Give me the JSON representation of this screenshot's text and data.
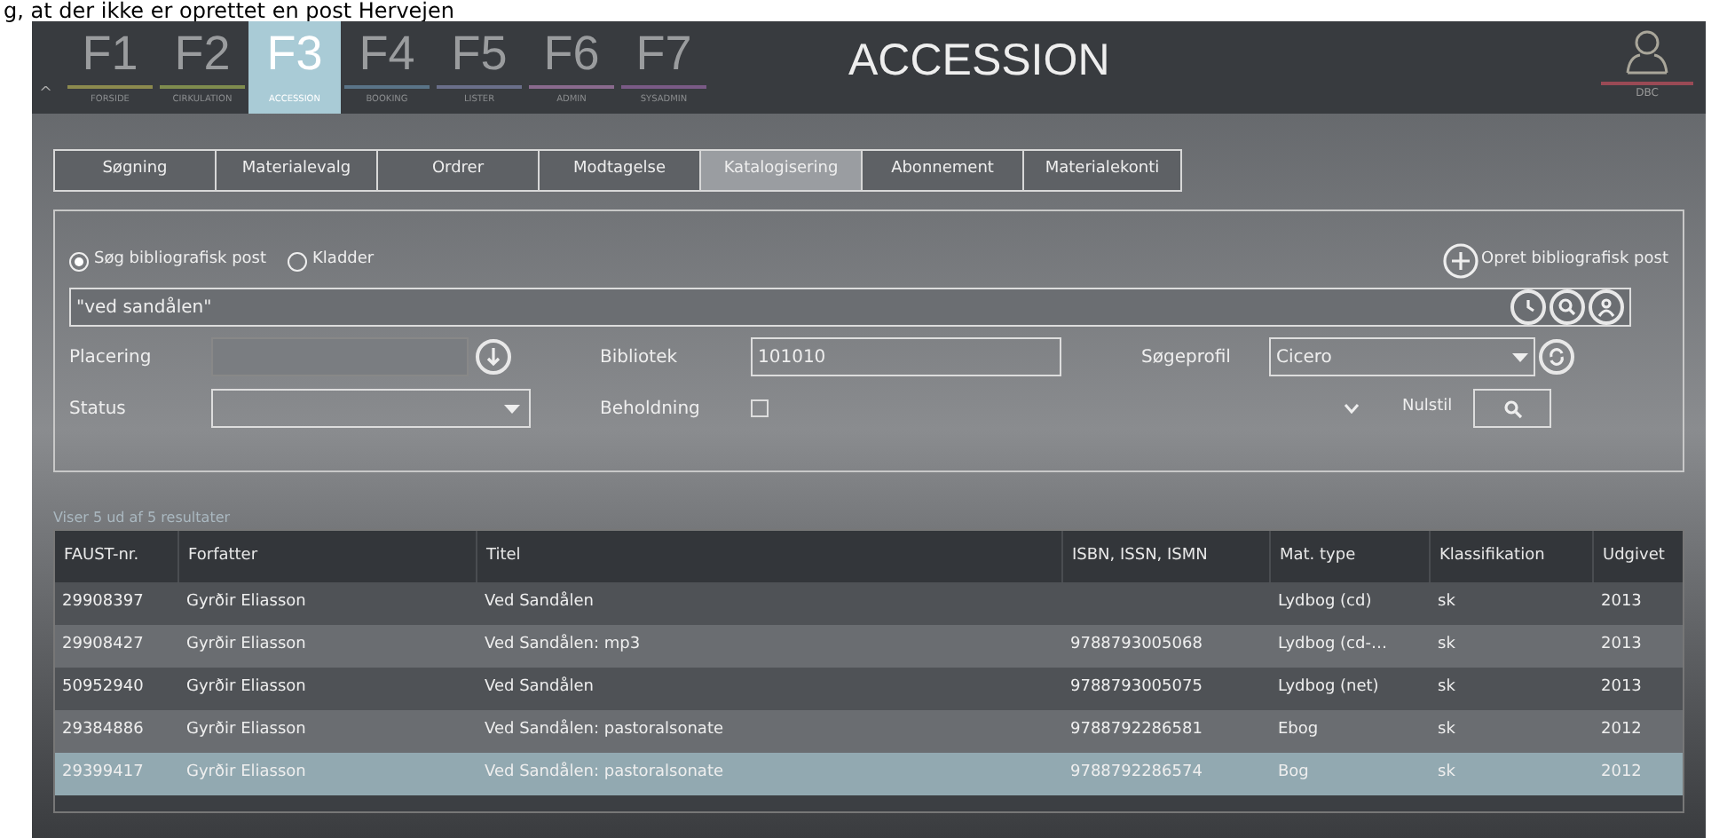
{
  "caption": "g, at der ikke er oprettet en post Hervejen",
  "modules": [
    {
      "key": "F1",
      "label": "FORSIDE",
      "color": "#8c8a4e",
      "selected": false
    },
    {
      "key": "F2",
      "label": "CIRKULATION",
      "color": "#7f8c4e",
      "selected": false
    },
    {
      "key": "F3",
      "label": "ACCESSION",
      "color": "#a9cbd6",
      "selected": true
    },
    {
      "key": "F4",
      "label": "BOOKING",
      "color": "#5a7488",
      "selected": false
    },
    {
      "key": "F5",
      "label": "LISTER",
      "color": "#6a6f8a",
      "selected": false
    },
    {
      "key": "F6",
      "label": "ADMIN",
      "color": "#8a6a8e",
      "selected": false
    },
    {
      "key": "F7",
      "label": "SYSADMIN",
      "color": "#7a5a86",
      "selected": false
    }
  ],
  "collapse_glyph": "^",
  "page_title": "ACCESSION",
  "user": {
    "label": "DBC"
  },
  "tabs": [
    {
      "label": "Søgning",
      "selected": false
    },
    {
      "label": "Materialevalg",
      "selected": false
    },
    {
      "label": "Ordrer",
      "selected": false
    },
    {
      "label": "Modtagelse",
      "selected": false
    },
    {
      "label": "Katalogisering",
      "selected": true
    },
    {
      "label": "Abonnement",
      "selected": false
    },
    {
      "label": "Materialekonti",
      "selected": false
    }
  ],
  "search_panel": {
    "modes": [
      {
        "label": "Søg bibliografisk post",
        "selected": true
      },
      {
        "label": "Kladder",
        "selected": false
      }
    ],
    "create_link": "Opret bibliografisk post",
    "query": "\"ved sandålen\"",
    "placering_label": "Placering",
    "bibliotek_label": "Bibliotek",
    "bibliotek_value": "101010",
    "soegeprofil_label": "Søgeprofil",
    "soegeprofil_value": "Cicero",
    "status_label": "Status",
    "beholdning_label": "Beholdning",
    "beholdning_checked": false,
    "reset": "Nulstil"
  },
  "results_summary": "Viser 5 ud af 5 resultater",
  "table": {
    "columns": [
      "FAUST-nr.",
      "Forfatter",
      "Titel",
      "ISBN, ISSN, ISMN",
      "Mat. type",
      "Klassifikation",
      "Udgivet"
    ],
    "rows": [
      {
        "cells": [
          "29908397",
          "Gyrðir Eliasson",
          "Ved Sandålen",
          "",
          "Lydbog (cd)",
          "sk",
          "2013"
        ],
        "selected": false
      },
      {
        "cells": [
          "29908427",
          "Gyrðir Eliasson",
          "Ved Sandålen: mp3",
          "9788793005068",
          "Lydbog (cd-…",
          "sk",
          "2013"
        ],
        "selected": false
      },
      {
        "cells": [
          "50952940",
          "Gyrðir Eliasson",
          "Ved Sandålen",
          "9788793005075",
          "Lydbog (net)",
          "sk",
          "2013"
        ],
        "selected": false
      },
      {
        "cells": [
          "29384886",
          "Gyrðir Eliasson",
          "Ved Sandålen: pastoralsonate",
          "9788792286581",
          "Ebog",
          "sk",
          "2012"
        ],
        "selected": false
      },
      {
        "cells": [
          "29399417",
          "Gyrðir Eliasson",
          "Ved Sandålen: pastoralsonate",
          "9788792286574",
          "Bog",
          "sk",
          "2012"
        ],
        "selected": true
      }
    ]
  }
}
